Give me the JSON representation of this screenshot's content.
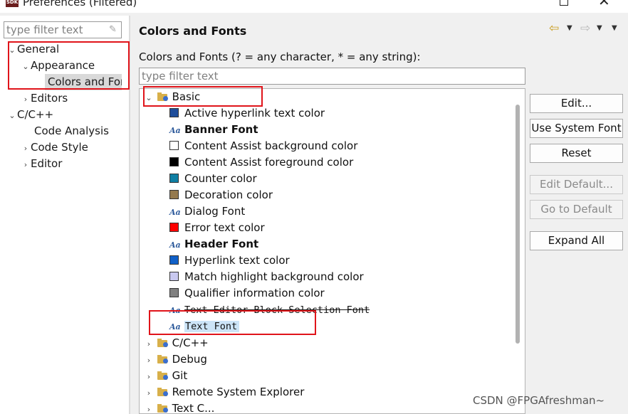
{
  "window": {
    "title": "Preferences (Filtered)",
    "icon_label": "SDK"
  },
  "left_pane": {
    "filter_placeholder": "type filter text",
    "tree": [
      {
        "label": "General",
        "expanded": true
      },
      {
        "label": "Appearance",
        "expanded": true
      },
      {
        "label": "Colors and Fonts",
        "selected": true
      },
      {
        "label": "Editors",
        "expanded": false
      },
      {
        "label": "C/C++",
        "expanded": true
      },
      {
        "label": "Code Analysis"
      },
      {
        "label": "Code Style",
        "expanded": false
      },
      {
        "label": "Editor",
        "expanded": false
      }
    ]
  },
  "right_pane": {
    "title": "Colors and Fonts",
    "description": "Colors and Fonts (? = any character, * = any string):",
    "filter_placeholder": "type filter text",
    "tree": {
      "basic": {
        "label": "Basic",
        "items": [
          {
            "label": "Active hyperlink text color",
            "kind": "color",
            "color": "#1f4e9b"
          },
          {
            "label": "Banner Font",
            "kind": "font",
            "bold": true
          },
          {
            "label": "Content Assist background color",
            "kind": "color",
            "color": "#ffffff"
          },
          {
            "label": "Content Assist foreground color",
            "kind": "color",
            "color": "#000000"
          },
          {
            "label": "Counter color",
            "kind": "color",
            "color": "#0f7fa3"
          },
          {
            "label": "Decoration color",
            "kind": "color",
            "color": "#957a4e"
          },
          {
            "label": "Dialog Font",
            "kind": "font"
          },
          {
            "label": "Error text color",
            "kind": "color",
            "color": "#ff0000"
          },
          {
            "label": "Header Font",
            "kind": "font",
            "bold": true
          },
          {
            "label": "Hyperlink text color",
            "kind": "color",
            "color": "#1060c8"
          },
          {
            "label": "Match highlight background color",
            "kind": "color",
            "color": "#c8c8f0"
          },
          {
            "label": "Qualifier information color",
            "kind": "color",
            "color": "#808080"
          },
          {
            "label": "Text Editor Block Selection Font",
            "kind": "font",
            "mono": true
          },
          {
            "label": "Text Font",
            "kind": "font",
            "mono": true,
            "selected": true
          }
        ]
      },
      "other_categories": [
        "C/C++",
        "Debug",
        "Git",
        "Remote System Explorer",
        "Text C..."
      ]
    },
    "buttons": {
      "edit": "Edit...",
      "use_system_font": "Use System Font",
      "reset": "Reset",
      "edit_default": "Edit Default...",
      "go_to_default": "Go to Default",
      "expand_all": "Expand All"
    }
  },
  "watermark": "CSDN @FPGAfreshman~",
  "colors": {
    "annotation_red": "#e0141a",
    "selection_blue": "#cce4f7"
  }
}
